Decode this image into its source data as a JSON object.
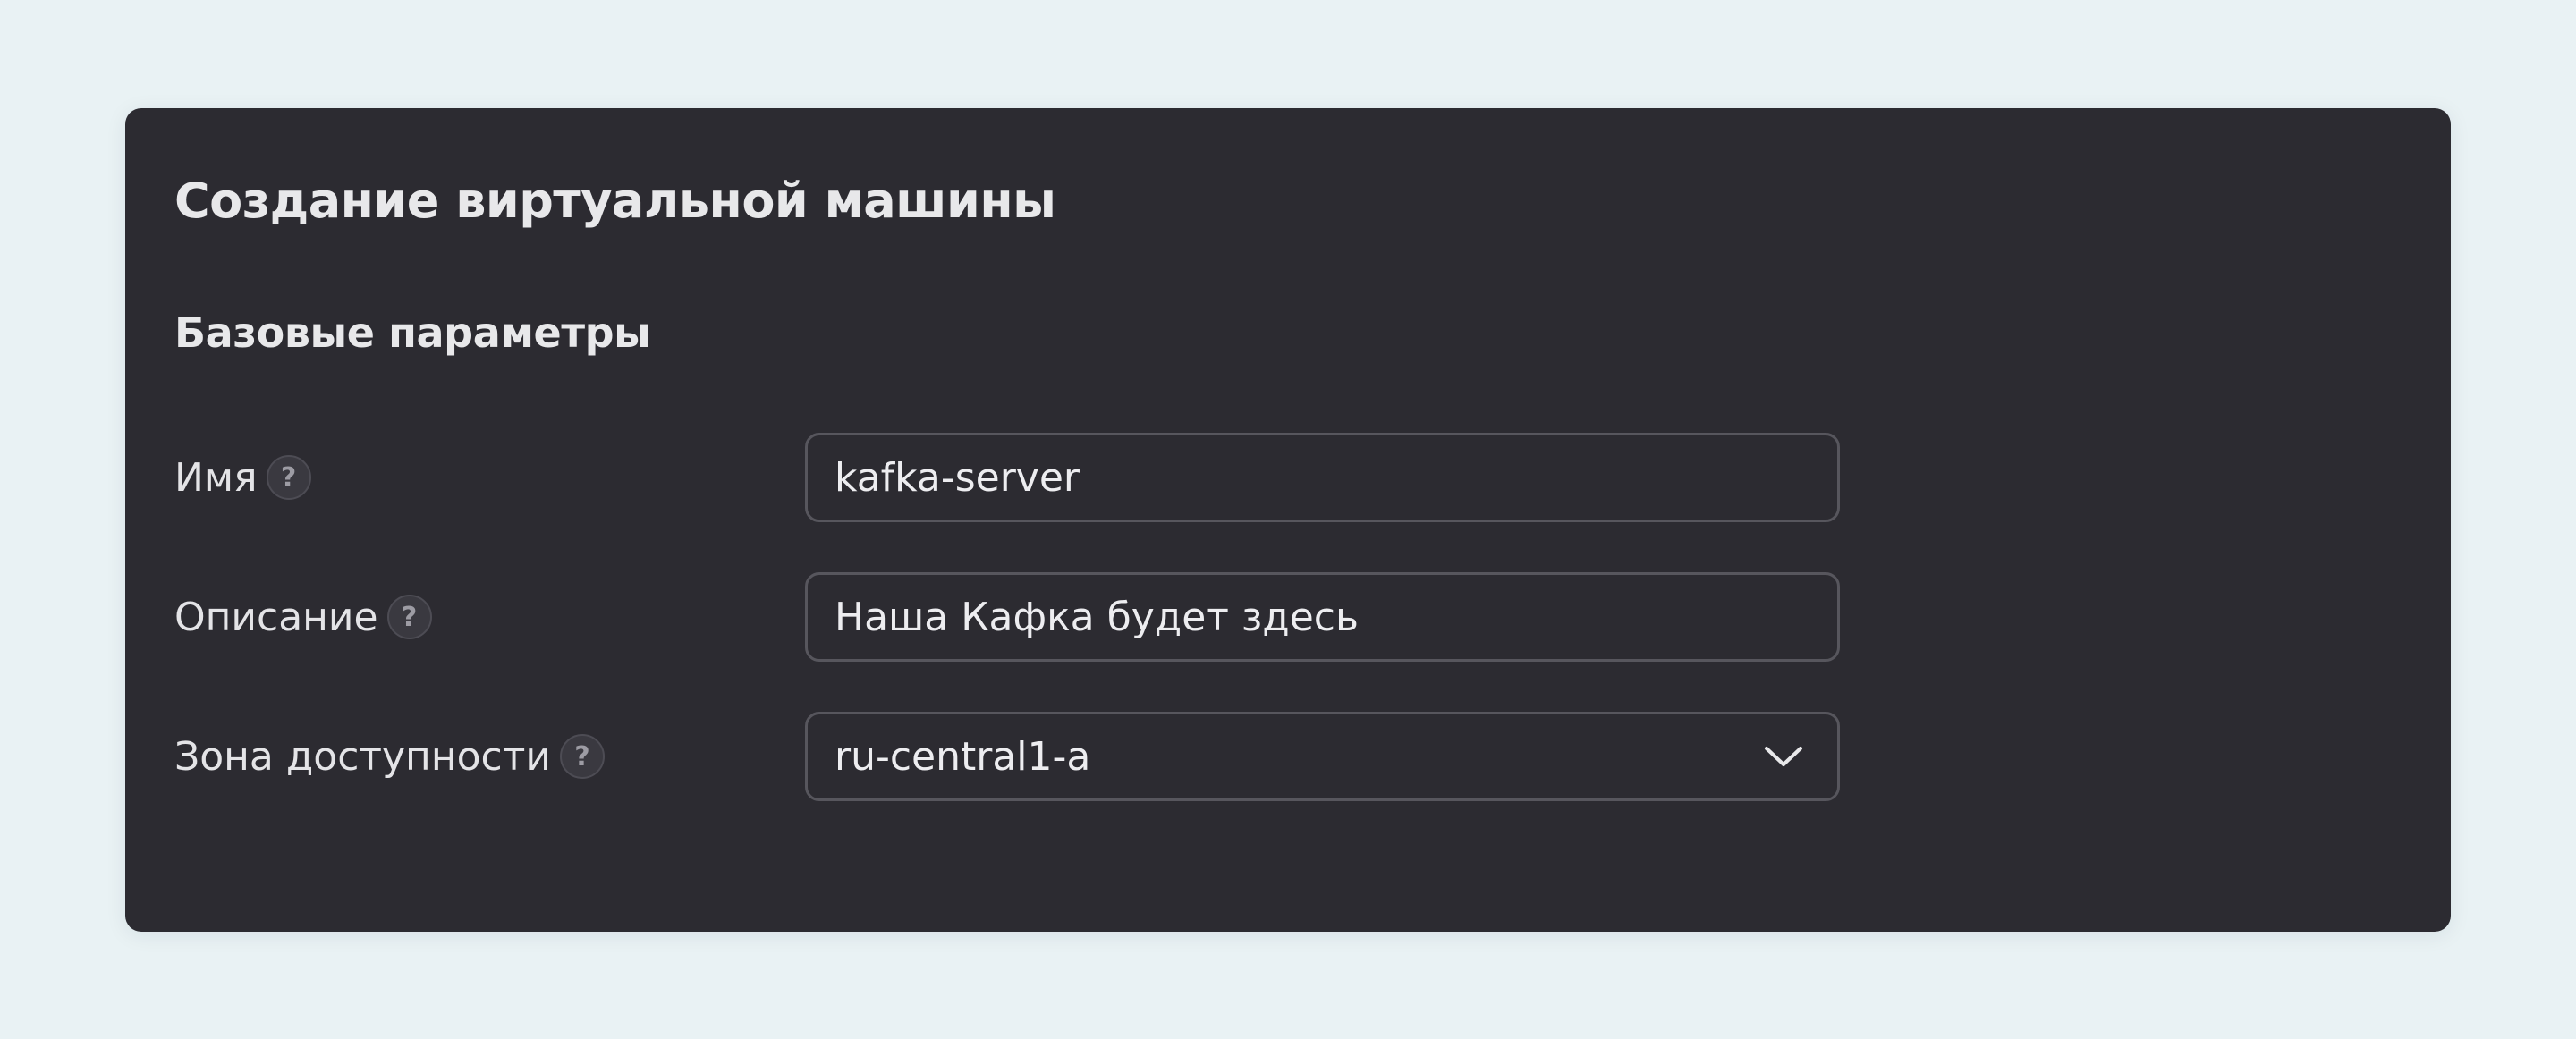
{
  "dialog": {
    "title": "Создание виртуальной машины",
    "section_title": "Базовые параметры"
  },
  "form": {
    "name": {
      "label": "Имя",
      "value": "kafka-server",
      "help_icon": "question-icon"
    },
    "description": {
      "label": "Описание",
      "value": "Наша Кафка будет здесь",
      "help_icon": "question-icon"
    },
    "zone": {
      "label": "Зона доступности",
      "selected": "ru-central1-a",
      "help_icon": "question-icon",
      "dropdown_icon": "chevron-down-icon"
    }
  },
  "help_glyph": "?",
  "colors": {
    "page_background": "#e9f2f4",
    "card_background": "#2c2b31",
    "field_border": "#57565d",
    "text": "#e8e8ea"
  }
}
